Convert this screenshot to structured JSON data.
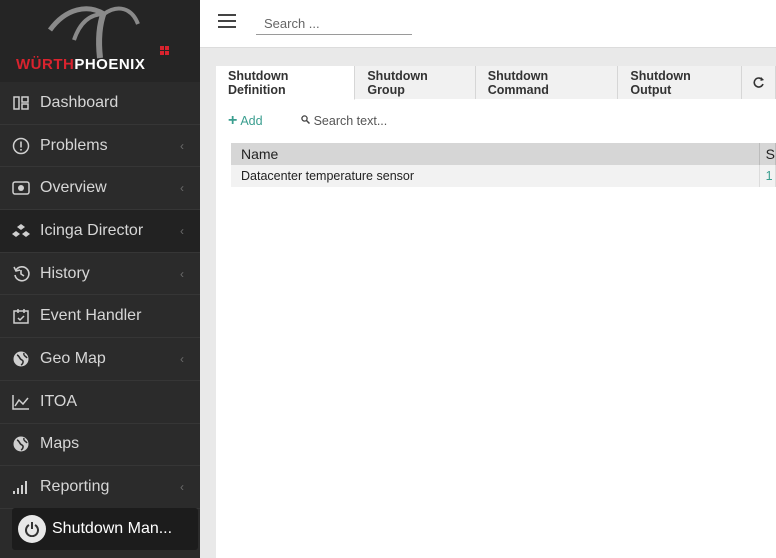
{
  "brand": {
    "logo_red": "WÜRTH",
    "logo_white": "PHOENIX"
  },
  "sidebar": {
    "items": [
      {
        "label": "Dashboard",
        "icon": "dashboard-icon",
        "chevron": false
      },
      {
        "label": "Problems",
        "icon": "exclamation-icon",
        "chevron": true
      },
      {
        "label": "Overview",
        "icon": "eye-icon",
        "chevron": true
      },
      {
        "label": "Icinga Director",
        "icon": "director-icon",
        "chevron": true
      },
      {
        "label": "History",
        "icon": "history-icon",
        "chevron": true
      },
      {
        "label": "Event Handler",
        "icon": "calendar-icon",
        "chevron": false
      },
      {
        "label": "Geo Map",
        "icon": "globe-icon",
        "chevron": true
      },
      {
        "label": "ITOA",
        "icon": "area-chart-icon",
        "chevron": false
      },
      {
        "label": "Maps",
        "icon": "globe-icon",
        "chevron": false
      },
      {
        "label": "Reporting",
        "icon": "bars-icon",
        "chevron": true
      }
    ],
    "active": {
      "label": "Shutdown Man...",
      "icon": "power-icon"
    },
    "chevron_glyph": "‹"
  },
  "topbar": {
    "search_placeholder": "Search ..."
  },
  "tabs": [
    {
      "label": "Shutdown Definition",
      "active": true
    },
    {
      "label": "Shutdown Group",
      "active": false
    },
    {
      "label": "Shutdown Command",
      "active": false
    },
    {
      "label": "Shutdown Output",
      "active": false
    }
  ],
  "toolbar": {
    "add_label": "Add",
    "filter_placeholder": "Search text..."
  },
  "table": {
    "headers": [
      "Name",
      "S"
    ],
    "rows": [
      [
        "Datacenter temperature sensor",
        "1"
      ]
    ]
  },
  "colors": {
    "accent": "#3a9e8f",
    "brand_red": "#d9232e",
    "sidebar_bg": "#2b2b2b"
  }
}
